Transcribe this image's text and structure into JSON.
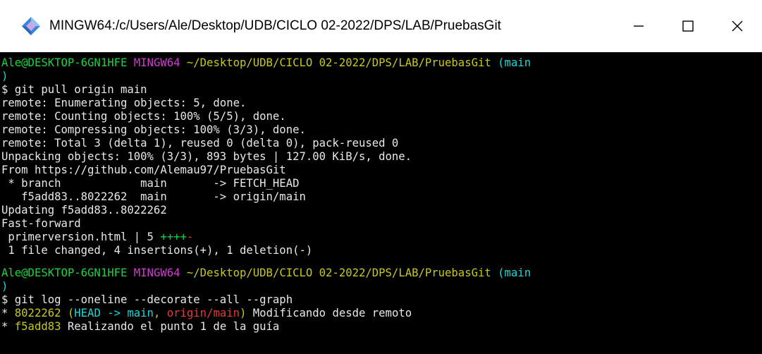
{
  "window": {
    "title": "MINGW64:/c/Users/Ale/Desktop/UDB/CICLO 02-2022/DPS/LAB/PruebasGit",
    "icon": "mingw-diamond-icon",
    "controls": [
      "minimize",
      "maximize",
      "close"
    ]
  },
  "colors": {
    "user_host": "#17d43f",
    "shell": "#d33ad3",
    "path": "#c8c81a",
    "branch": "#1ed6d6",
    "remote_ref": "#e53a3a",
    "text": "#e8e8e8"
  },
  "prompt1": {
    "user_host": "Ale@DESKTOP-6GN1HFE",
    "shell": "MINGW64",
    "path": "~/Desktop/UDB/CICLO 02-2022/DPS/LAB/PruebasGit",
    "branch_open": "(main",
    "branch_close": ")"
  },
  "cmd1": "$ git pull origin main",
  "pull_output": [
    "remote: Enumerating objects: 5, done.",
    "remote: Counting objects: 100% (5/5), done.",
    "remote: Compressing objects: 100% (3/3), done.",
    "remote: Total 3 (delta 1), reused 0 (delta 0), pack-reused 0",
    "Unpacking objects: 100% (3/3), 893 bytes | 127.00 KiB/s, done.",
    "From https://github.com/Alemau97/PruebasGit",
    " * branch            main       -> FETCH_HEAD",
    "   f5add83..8022262  main       -> origin/main",
    "Updating f5add83..8022262",
    "Fast-forward"
  ],
  "diffstat": {
    "file": " primerversion.html | 5 ",
    "plus": "++++",
    "minus": "-"
  },
  "summary": " 1 file changed, 4 insertions(+), 1 deletion(-)",
  "prompt2": {
    "user_host": "Ale@DESKTOP-6GN1HFE",
    "shell": "MINGW64",
    "path": "~/Desktop/UDB/CICLO 02-2022/DPS/LAB/PruebasGit",
    "branch_open": "(main",
    "branch_close": ")"
  },
  "cmd2": "$ git log --oneline --decorate --all --graph",
  "log": [
    {
      "graph": "* ",
      "hash": "8022262",
      "head": "HEAD -> main",
      "remote": "origin/main",
      "message": "Modificando desde remoto"
    },
    {
      "graph": "* ",
      "hash": "f5add83",
      "message": "Realizando el punto 1 de la guía"
    }
  ]
}
